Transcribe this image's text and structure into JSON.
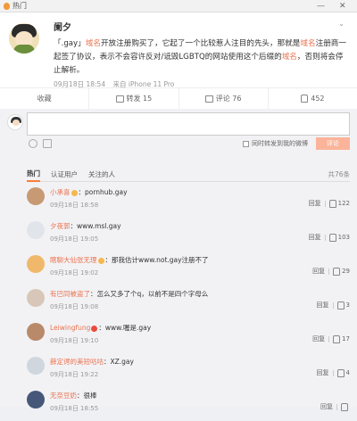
{
  "topbar": {
    "hot_label": "热门",
    "minimize": "—",
    "close": "✕"
  },
  "post": {
    "author": "阑夕",
    "segments": [
      {
        "t": "「.gay」",
        "c": "text"
      },
      {
        "t": "域名",
        "c": "hl"
      },
      {
        "t": "开放注册购买了，它起了一个比较惹人注目的先头，那就是",
        "c": "text"
      },
      {
        "t": "域名",
        "c": "hl"
      },
      {
        "t": "注册商一起签了协议，表示不会容许反对/诋毁LGBTQ的网站使用这个后缀的",
        "c": "text"
      },
      {
        "t": "域名",
        "c": "hl"
      },
      {
        "t": "，否则将会停止解析。",
        "c": "text"
      }
    ],
    "time": "09月18日 18:54",
    "source": "来自 iPhone 11 Pro"
  },
  "actions": {
    "collect": "收藏",
    "repost": "转发 15",
    "comment": "评论 76",
    "like": "452"
  },
  "compose": {
    "sync_label": "同时转发到我的微博",
    "submit": "评论"
  },
  "tabs": {
    "items": [
      "热门",
      "认证用户",
      "关注的人"
    ],
    "total": "共76条"
  },
  "comments": [
    {
      "name": "小承喜",
      "badge": "gold",
      "text": "：pornhub.gay",
      "time": "09月18日 18:58",
      "reply": "回复",
      "likes": "122",
      "avatar_color": "#c79a74"
    },
    {
      "name": "夕夜郭",
      "badge": "",
      "text": "：www.msl.gay",
      "time": "09月18日 19:05",
      "reply": "回复",
      "likes": "103",
      "avatar_color": "#e1e4ea"
    },
    {
      "name": "瞎聊大仙张无理",
      "badge": "gold",
      "text": "：那我估计www.not.gay注册不了",
      "time": "09月18日 19:02",
      "reply": "回复",
      "likes": "29",
      "avatar_color": "#f0b86a"
    },
    {
      "name": "有巴同被盗了",
      "badge": "",
      "text": "：怎么又多了个q，以前不是四个字母么",
      "time": "09月18日 19:08",
      "reply": "回复",
      "likes": "3",
      "avatar_color": "#d8c7b8"
    },
    {
      "name": "Leiwingfung",
      "badge": "red",
      "text": "：www.喔是.gay",
      "time": "09月18日 19:10",
      "reply": "回复",
      "likes": "17",
      "avatar_color": "#b88a6a"
    },
    {
      "name": "薛定谔的美短咕咕",
      "badge": "",
      "text": "：XZ.gay",
      "time": "09月18日 19:22",
      "reply": "回复",
      "likes": "4",
      "avatar_color": "#cfd6de"
    },
    {
      "name": "无奈豆奶",
      "badge": "",
      "text": "：很棒",
      "time": "09月18日 18:55",
      "reply": "回复",
      "likes": "",
      "avatar_color": "#46587a"
    }
  ]
}
